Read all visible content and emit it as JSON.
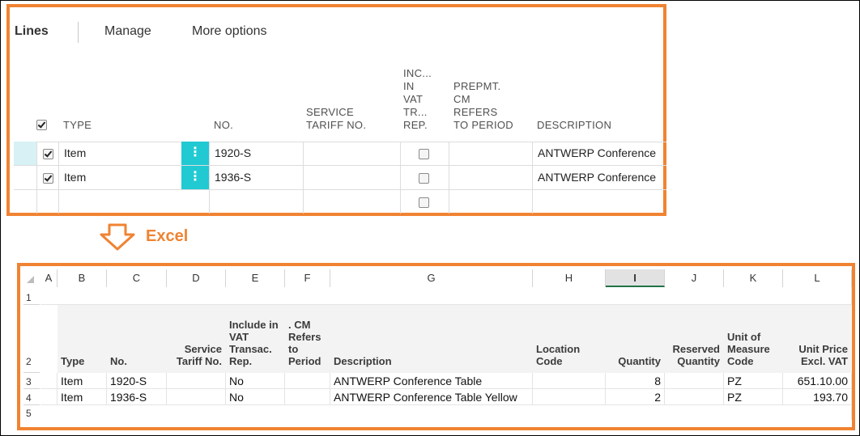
{
  "bc": {
    "tabs": [
      "Lines",
      "Manage",
      "More options"
    ],
    "headers": {
      "type": "TYPE",
      "no": "NO.",
      "service_tariff": [
        "SERVICE",
        "TARIFF NO."
      ],
      "include_vat": [
        "INC...",
        "IN",
        "VAT",
        "TR...",
        "REP."
      ],
      "prepmt": [
        "PREPMT.",
        "CM",
        "REFERS",
        "TO PERIOD"
      ],
      "description": "DESCRIPTION"
    },
    "rows": [
      {
        "selected": true,
        "type": "Item",
        "no": "1920-S",
        "include_vat": false,
        "description": "ANTWERP Conference"
      },
      {
        "selected": true,
        "type": "Item",
        "no": "1936-S",
        "include_vat": false,
        "description": "ANTWERP Conference"
      },
      {
        "selected": false,
        "type": "",
        "no": "",
        "include_vat": false,
        "description": ""
      }
    ],
    "accent": "#21c9d3"
  },
  "arrow_label": "Excel",
  "excel": {
    "columns": [
      "A",
      "B",
      "C",
      "D",
      "E",
      "F",
      "G",
      "H",
      "I",
      "J",
      "K",
      "L"
    ],
    "selected_column": "I",
    "row_numbers": [
      "1",
      "2",
      "3",
      "4",
      "5"
    ],
    "headers": {
      "type": "Type",
      "no": "No.",
      "service": [
        "Service",
        "Tariff No."
      ],
      "include": [
        "Include in",
        "VAT",
        "Transac.",
        "Rep."
      ],
      "cm": [
        ". CM",
        "Refers",
        "to",
        "Period"
      ],
      "description": "Description",
      "location": [
        "Location",
        "Code"
      ],
      "quantity": "Quantity",
      "reserved": [
        "Reserved",
        "Quantity"
      ],
      "uom": [
        "Unit of",
        "Measure",
        "Code"
      ],
      "price": [
        "Unit Price",
        "Excl. VAT"
      ]
    },
    "rows": [
      {
        "type": "Item",
        "no": "1920-S",
        "include": "No",
        "description": "ANTWERP Conference Table",
        "quantity": "8",
        "uom": "PZ",
        "price": "651.10.00"
      },
      {
        "type": "Item",
        "no": "1936-S",
        "include": "No",
        "description": "ANTWERP Conference Table Yellow",
        "quantity": "2",
        "uom": "PZ",
        "price": "193.70"
      }
    ]
  },
  "colors": {
    "highlight": "#f08332",
    "excel_green": "#217346"
  }
}
